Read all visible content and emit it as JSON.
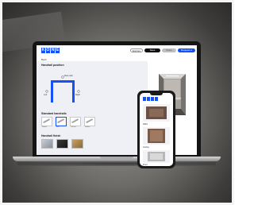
{
  "app": {
    "logo_letters": [
      "K",
      "O",
      "N",
      "E"
    ],
    "header_buttons": [
      {
        "label": "Explore"
      },
      {
        "label": "Save design"
      },
      {
        "label": "Share"
      },
      {
        "label": "Request a quote"
      }
    ],
    "tab_back": "Back"
  },
  "config": {
    "sections": [
      {
        "title": "Handrail position"
      },
      {
        "title": "Standard handrails"
      },
      {
        "title": "Handrail finish"
      }
    ],
    "diagram_labels": [
      "Rear wall",
      "Left",
      "Right"
    ],
    "handrails": [
      {
        "name": "Round",
        "selected": false
      },
      {
        "name": "Flat",
        "selected": true
      },
      {
        "name": "Curved",
        "selected": false
      },
      {
        "name": "Square",
        "selected": false
      }
    ],
    "finishes": [
      {
        "name": "Brushed steel",
        "color": "#9aa1ad"
      },
      {
        "name": "Black",
        "color": "#2a2a2a"
      },
      {
        "name": "Bronze",
        "color": "#a98448"
      }
    ]
  },
  "phone": {
    "labels": [
      "Walls",
      "Ceiling",
      "Floor"
    ]
  },
  "colors": {
    "accent": "#1450f5"
  }
}
